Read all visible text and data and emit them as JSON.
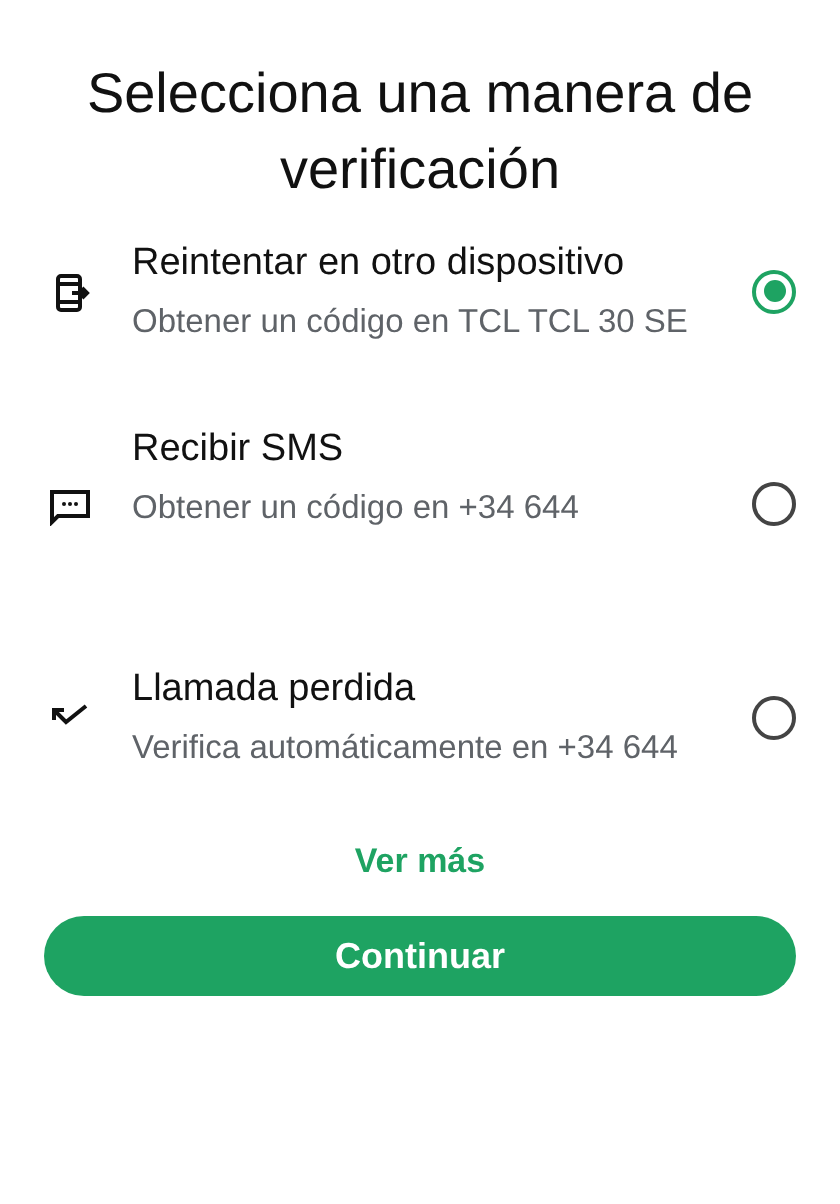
{
  "title": "Selecciona una manera de verificación",
  "options": [
    {
      "kind": "device",
      "label": "Reintentar en otro dispositivo",
      "description": "Obtener un código en TCL TCL 30 SE",
      "selected": true
    },
    {
      "kind": "sms",
      "label": "Recibir SMS",
      "description": "Obtener un código en +34 644",
      "selected": false
    },
    {
      "kind": "call",
      "label": "Llamada perdida",
      "description": "Verifica automáticamente en +34 644",
      "selected": false
    }
  ],
  "more_link": "Ver más",
  "continue_button": "Continuar"
}
